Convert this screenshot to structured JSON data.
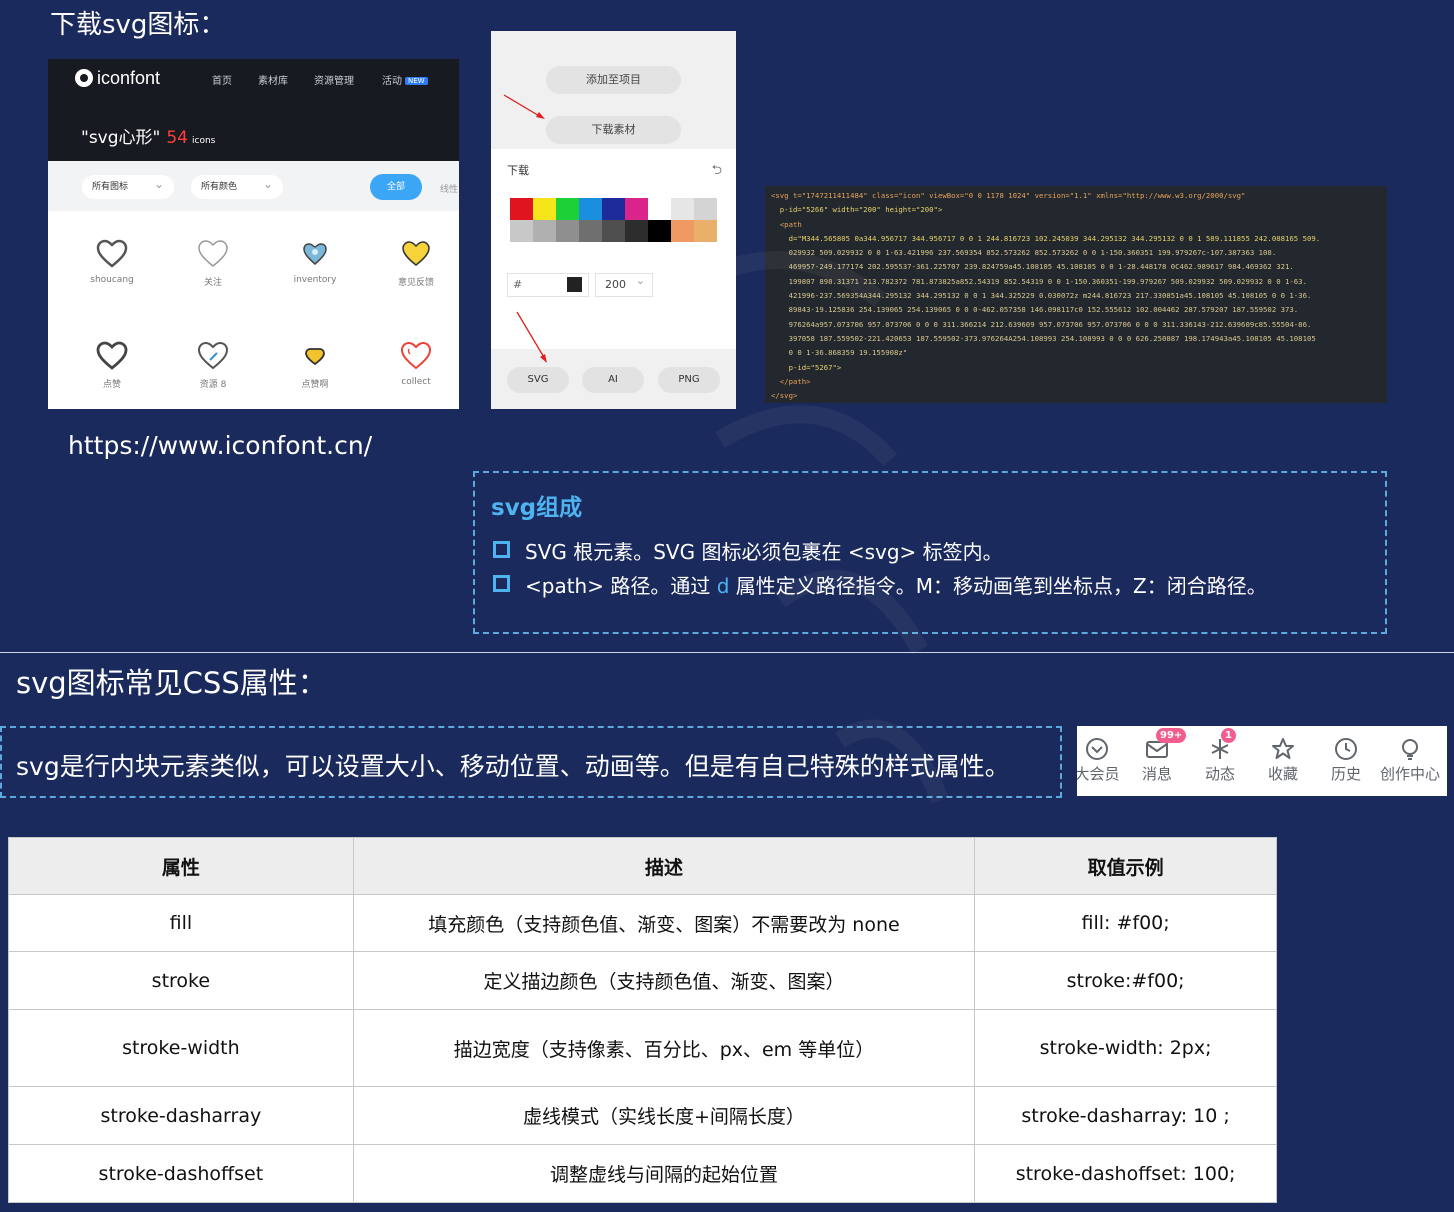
{
  "headings": {
    "download_title": "下载svg图标：",
    "css_title": "svg图标常见CSS属性：",
    "url": "https://www.iconfont.cn/"
  },
  "iconfont": {
    "logo": "iconfont",
    "nav": [
      "首页",
      "素材库",
      "资源管理",
      "活动"
    ],
    "new_badge": "NEW",
    "title": "\"svg心形\"",
    "count": "54",
    "count_suffix": "icons",
    "filter_icons": "所有图标",
    "filter_colors": "所有颜色",
    "all_button": "全部",
    "more": "线性",
    "icons": [
      {
        "label": "shoucang",
        "icon": "heart-outline-icon"
      },
      {
        "label": "关注",
        "icon": "heart-thin-icon"
      },
      {
        "label": "inventory",
        "icon": "heart-blue-icon"
      },
      {
        "label": "意见反馈",
        "icon": "heart-yellow-icon"
      },
      {
        "label": "点赞",
        "icon": "heart-outline-icon"
      },
      {
        "label": "资源 8",
        "icon": "heart-pen-icon"
      },
      {
        "label": "点赞啊",
        "icon": "heart-filled-small-icon"
      },
      {
        "label": "collect",
        "icon": "heart-red-icon"
      }
    ]
  },
  "download_panel": {
    "add_to_project": "添加至项目",
    "download_asset": "下载素材",
    "section_label": "下载",
    "hex_placeholder": "#",
    "size_value": "200",
    "formats": [
      "SVG",
      "AI",
      "PNG"
    ],
    "swatch_colors_row1": [
      "#e0141e",
      "#f7e51b",
      "#1bd137",
      "#1a8fe0",
      "#1d2a9a",
      "#d9248c",
      "#ffffff",
      "#e6e6e6",
      "#d4d4d4"
    ],
    "swatch_colors_row2": [
      "#c8c8c8",
      "#b0b0b0",
      "#8f8f8f",
      "#6f6f6f",
      "#4e4e4e",
      "#2d2d2d",
      "#000000",
      "#ef9a62",
      "#e8b06a"
    ]
  },
  "code_lines": [
    "<svg t=\"1747211411484\" class=\"icon\" viewBox=\"0 0 1178 1024\" version=\"1.1\" xmlns=\"http://www.w3.org/2000/svg\"",
    "  p-id=\"5266\" width=\"200\" height=\"200\">",
    "  <path",
    "    d=\"M344.565805 0a344.956717 344.956717 0 0 1 244.816723 102.245039 344.295132 344.295132 0 0 1 589.111855 242.088165 509.",
    "    029932 509.029932 0 0 1-63.421996 237.569354 852.573262 852.573262 0 0 1-150.360351 199.979267c-107.387363 108.",
    "    469957-249.177174 202.595537-361.225707 239.824759a45.108105 45.108105 0 0 1-28.448178 0C462.989617 984.469362 321.",
    "    199807 898.31371 213.782372 781.873825a852.54319 852.54319 0 0 1-150.360351-199.979267 509.029932 509.029932 0 0 1-63.",
    "    421996-237.569354A344.295132 344.295132 0 0 1 344.325229 0.030072z m244.816723 217.330851a45.108105 45.108105 0 0 1-36.",
    "    89843-19.125836 254.139065 254.139065 0 0 0-462.057358 146.098117c0 152.555612 102.004462 287.579207 187.559502 373.",
    "    976264a957.073706 957.073706 0 0 0 311.366214 212.639609 957.073706 957.073706 0 0 0 311.336143-212.639609c85.55504-86.",
    "    397058 187.559502-221.420653 187.559502-373.976264A254.108993 254.108993 0 0 0 626.250887 198.174943a45.108105 45.108105",
    "    0 0 1-36.868359 19.155908z\"",
    "    p-id=\"5267\">",
    "  </path>",
    "</svg>"
  ],
  "svg_box": {
    "title": "svg组成",
    "bullet1": "SVG 根元素。SVG 图标必须包裹在 <svg> 标签内。",
    "bullet2_pre": "<path> 路径。通过 ",
    "bullet2_hl": "d",
    "bullet2_post": " 属性定义路径指令。M：移动画笔到坐标点，Z：闭合路径。"
  },
  "inline_note": "svg是行内块元素类似，可以设置大小、移动位置、动画等。但是有自己特殊的样式属性。",
  "nav_icons": [
    {
      "label": "大会员",
      "icon": "vip-icon"
    },
    {
      "label": "消息",
      "icon": "message-icon",
      "badge": "99+"
    },
    {
      "label": "动态",
      "icon": "dynamic-icon",
      "badge": "1"
    },
    {
      "label": "收藏",
      "icon": "star-icon"
    },
    {
      "label": "历史",
      "icon": "clock-icon"
    },
    {
      "label": "创作中心",
      "icon": "bulb-icon"
    }
  ],
  "table": {
    "headers": [
      "属性",
      "描述",
      "取值示例"
    ],
    "rows": [
      [
        "fill",
        "填充颜色（支持颜色值、渐变、图案）不需要改为 none",
        "fill: #f00;"
      ],
      [
        "stroke",
        "定义描边颜色（支持颜色值、渐变、图案）",
        "stroke:#f00;"
      ],
      [
        "stroke-width",
        "描边宽度（支持像素、百分比、px、em 等单位）",
        "stroke-width: 2px;"
      ],
      [
        "stroke-dasharray",
        "虚线模式（实线长度+间隔长度）",
        "stroke-dasharray: 10 ;"
      ],
      [
        "stroke-dashoffset",
        "调整虚线与间隔的起始位置",
        "stroke-dashoffset: 100;"
      ]
    ]
  },
  "colors": {
    "background": "#1b2a5c",
    "accent": "#4fb3f0",
    "arrow": "#e02020"
  }
}
